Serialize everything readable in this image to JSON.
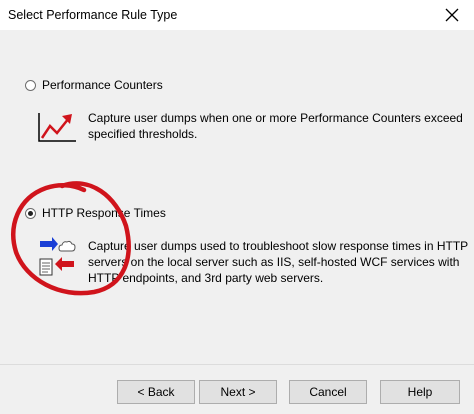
{
  "window": {
    "title": "Select Performance Rule Type",
    "close_icon": "close-icon"
  },
  "options": [
    {
      "label": "Performance Counters",
      "selected": false,
      "icon": "trend-chart-icon",
      "description_lines": [
        "Capture user dumps when one or more Performance Counters exceed",
        "specified thresholds."
      ]
    },
    {
      "label": "HTTP Response Times",
      "selected": true,
      "icon": "http-request-response-icon",
      "description_lines": [
        "Capture user dumps used to troubleshoot slow response times in HTTP",
        "servers on the local server such as IIS, self-hosted WCF services with",
        "HTTP endpoints, and 3rd party web servers."
      ]
    }
  ],
  "buttons": {
    "back": "< Back",
    "next": "Next >",
    "cancel": "Cancel",
    "help": "Help"
  },
  "colors": {
    "annotation_circle": "#d0141c",
    "chart_line": "#d0141c",
    "arrow_right": "#1a3fd6",
    "arrow_left": "#d0141c"
  }
}
